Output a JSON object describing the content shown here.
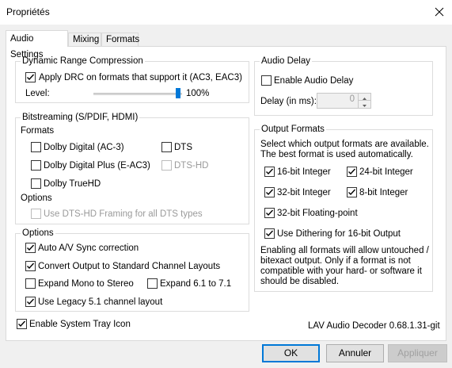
{
  "window": {
    "title": "Propriétés"
  },
  "tabs": [
    "Audio Settings",
    "Mixing",
    "Formats"
  ],
  "drc": {
    "title": "Dynamic Range Compression",
    "apply_label": "Apply DRC on formats that support it (AC3, EAC3)",
    "apply_checked": true,
    "level_label": "Level:",
    "level_value": "100%",
    "level_fraction": 1.0
  },
  "bitstreaming": {
    "title": "Bitstreaming (S/PDIF, HDMI)",
    "formats_label": "Formats",
    "dolby_digital": "Dolby Digital (AC-3)",
    "dts": "DTS",
    "dolby_digital_plus": "Dolby Digital Plus (E-AC3)",
    "dts_hd": "DTS-HD",
    "dolby_truehd": "Dolby TrueHD",
    "options_label": "Options",
    "dts_hd_framing": "Use DTS-HD Framing for all DTS types"
  },
  "options": {
    "title": "Options",
    "av_sync": "Auto A/V Sync correction",
    "convert_output": "Convert Output to Standard Channel Layouts",
    "expand_mono": "Expand Mono to Stereo",
    "expand_61": "Expand 6.1 to 7.1",
    "legacy_51": "Use Legacy 5.1 channel layout"
  },
  "audio_delay": {
    "title": "Audio Delay",
    "enable_label": "Enable Audio Delay",
    "delay_label": "Delay (in ms):",
    "delay_value": "0"
  },
  "output_formats": {
    "title": "Output Formats",
    "description_line1": "Select which output formats are available.",
    "description_line2": "The best format is used automatically.",
    "int16": "16-bit Integer",
    "int24": "24-bit Integer",
    "int32": "32-bit Integer",
    "int8": "8-bit Integer",
    "float32": "32-bit Floating-point",
    "dithering": "Use Dithering for 16-bit Output",
    "note_line1": "Enabling all formats will allow untouched /",
    "note_line2": "bitexact output. Only if a format is not",
    "note_line3": "compatible with your hard- or software it",
    "note_line4": "should be disabled."
  },
  "tray": {
    "label": "Enable System Tray Icon",
    "checked": true
  },
  "version": "LAV Audio Decoder 0.68.1.31-git",
  "buttons": {
    "ok": "OK",
    "cancel": "Annuler",
    "apply": "Appliquer"
  },
  "colors": {
    "accent": "#0078d7",
    "disabled_text": "#9a9a9a"
  }
}
